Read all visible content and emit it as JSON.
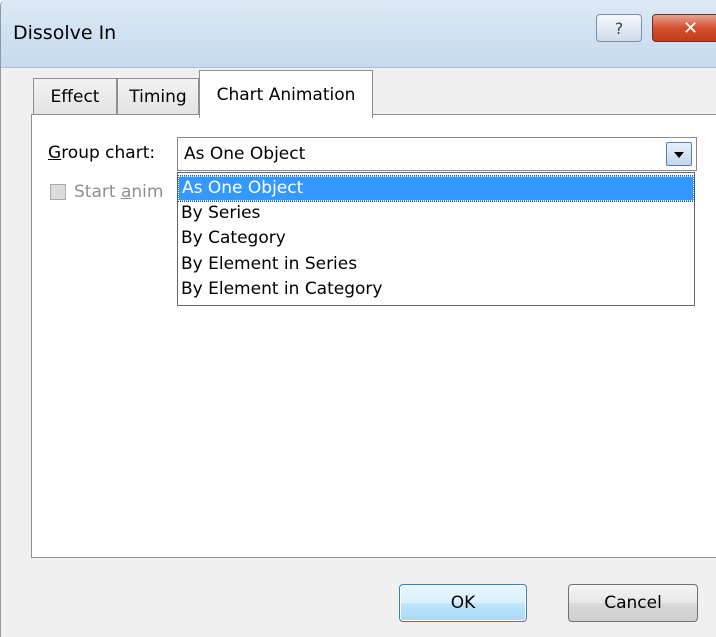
{
  "window": {
    "title": "Dissolve In",
    "help_label": "?",
    "close_label": "✕"
  },
  "tabs": [
    {
      "label": "Effect",
      "active": false
    },
    {
      "label": "Timing",
      "active": false
    },
    {
      "label": "Chart Animation",
      "active": true
    }
  ],
  "group_chart": {
    "label_prefix": "G",
    "label_rest": "roup chart:",
    "selected_value": "As One Object",
    "options": [
      "As One Object",
      "By Series",
      "By Category",
      "By Element in Series",
      "By Element in Category"
    ]
  },
  "start_animation": {
    "label_visible": "Start ",
    "label_underlined": "a",
    "label_tail": "nim",
    "checked": false,
    "enabled": false
  },
  "buttons": {
    "ok_label": "OK",
    "cancel_label": "Cancel"
  },
  "colors": {
    "selection": "#3399ff",
    "close_button": "#c8452a",
    "titlebar": "#d2e2f2"
  }
}
